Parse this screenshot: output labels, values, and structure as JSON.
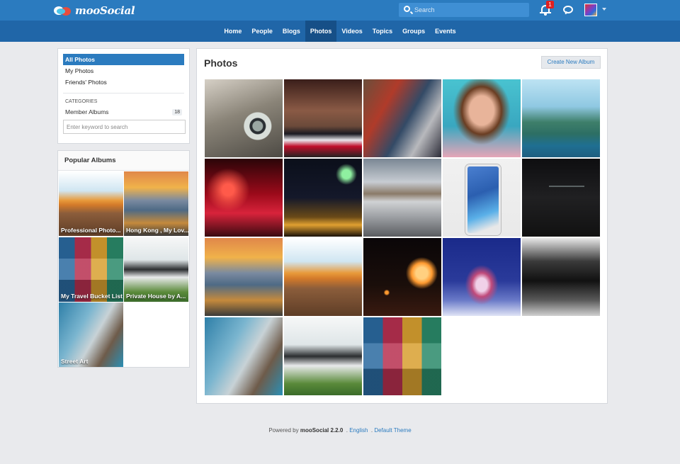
{
  "brand": {
    "logo_text": "mooSocial"
  },
  "header": {
    "search_placeholder": "Search",
    "notification_count": "1"
  },
  "nav": {
    "items": [
      {
        "label": "Home"
      },
      {
        "label": "People"
      },
      {
        "label": "Blogs"
      },
      {
        "label": "Photos"
      },
      {
        "label": "Videos"
      },
      {
        "label": "Topics"
      },
      {
        "label": "Groups"
      },
      {
        "label": "Events"
      }
    ],
    "active": "Photos"
  },
  "sidebar": {
    "menu": [
      {
        "label": "All Photos"
      },
      {
        "label": "My Photos"
      },
      {
        "label": "Friends' Photos"
      }
    ],
    "categories_heading": "CATEGORIES",
    "category": {
      "label": "Member Albums",
      "count": "18"
    },
    "keyword_placeholder": "Enter keyword to search"
  },
  "popular": {
    "title": "Popular Albums",
    "albums": [
      {
        "label": "Professional Photo..."
      },
      {
        "label": "Hong Kong , My Lov..."
      },
      {
        "label": "My Travel Bucket List"
      },
      {
        "label": "Private House by A..."
      },
      {
        "label": "Street Art"
      }
    ]
  },
  "main": {
    "title": "Photos",
    "create_button": "Create New Album",
    "photos_count_visible": 18
  },
  "footer": {
    "powered_prefix": "Powered by",
    "powered_brand": "mooSocial 2.2.0",
    "language": "English",
    "theme": "Default Theme"
  },
  "colors": {
    "topbar": "#2b7bbf",
    "navbar": "#2066a8",
    "accent": "#2b7bbf",
    "background": "#e9eaed"
  }
}
